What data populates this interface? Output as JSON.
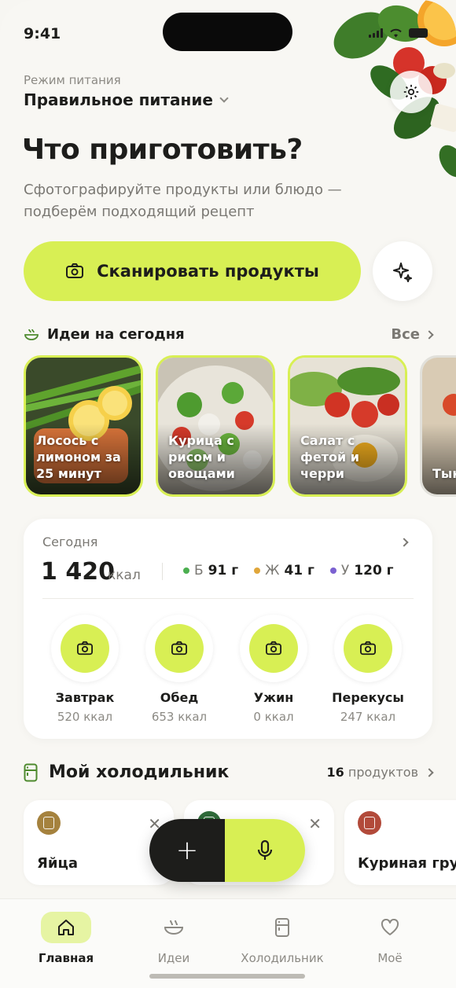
{
  "status": {
    "time": "9:41"
  },
  "mode": {
    "label": "Режим питания",
    "value": "Правильное питание"
  },
  "hero": {
    "title": "Что приготовить?",
    "subtitle": "Сфотографируйте продукты или блюдо — подберём подходящий рецепт"
  },
  "scan": {
    "label": "Сканировать продукты"
  },
  "ideas": {
    "title": "Идеи на сегодня",
    "all_label": "Все",
    "items": [
      {
        "label": "Лосось с лимоном за 25 минут"
      },
      {
        "label": "Курица с рисом и овощами"
      },
      {
        "label": "Салат с фетой и черри"
      },
      {
        "label": "Тык суп"
      }
    ]
  },
  "today": {
    "label": "Сегодня",
    "kcal": "1 420",
    "kcal_unit": "ккал",
    "macros": [
      {
        "letter": "Б",
        "value": "91 г",
        "color": "#4caf50"
      },
      {
        "letter": "Ж",
        "value": "41 г",
        "color": "#e0a63a"
      },
      {
        "letter": "У",
        "value": "120 г",
        "color": "#7b61d1"
      }
    ],
    "meals": [
      {
        "name": "Завтрак",
        "kcal": "520 ккал"
      },
      {
        "name": "Обед",
        "kcal": "653 ккал"
      },
      {
        "name": "Ужин",
        "kcal": "0 ккал"
      },
      {
        "name": "Перекусы",
        "kcal": "247 ккал"
      }
    ]
  },
  "fridge": {
    "title": "Мой холодильник",
    "count": "16",
    "count_label": "продуктов",
    "items": [
      {
        "name": "Яйца",
        "color": "#a5823e"
      },
      {
        "name": "",
        "color": "#2f6b3a"
      },
      {
        "name": "Куриная грудка",
        "color": "#b24a3a"
      }
    ]
  },
  "fab": {
    "add": "+"
  },
  "tabs": [
    {
      "label": "Главная",
      "active": true
    },
    {
      "label": "Идеи"
    },
    {
      "label": "Холодильник"
    },
    {
      "label": "Моё"
    }
  ],
  "colors": {
    "accent": "#d8ef54",
    "dark": "#1d1d1b"
  }
}
